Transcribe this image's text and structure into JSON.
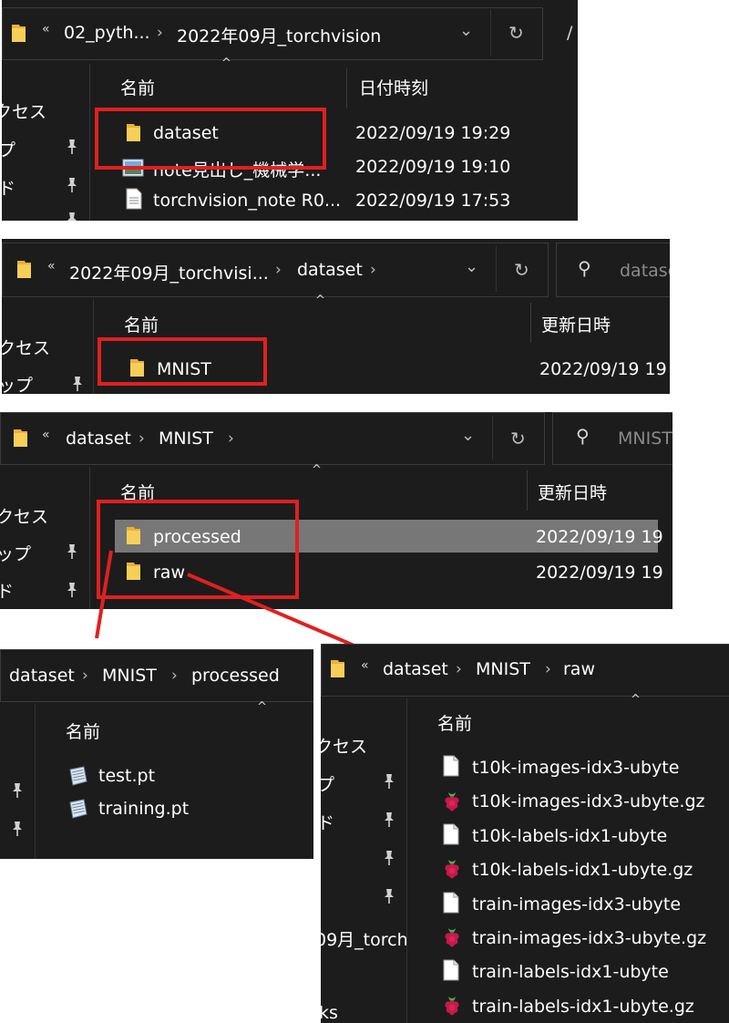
{
  "p1": {
    "breadcrumb": [
      "02_pyth...",
      "2022年09月_torchvision"
    ],
    "prefix": "«",
    "col_name": "名前",
    "col_date": "日付時刻",
    "side": [
      "クセス",
      "プ",
      "ド"
    ],
    "rows": [
      {
        "name": "dataset",
        "date": "2022/09/19 19:29",
        "icon": "folder-icon"
      },
      {
        "name": "note見出し_機械学...",
        "date": "2022/09/19 19:10",
        "icon": "image-file-icon"
      },
      {
        "name": "torchvision_note R0...",
        "date": "2022/09/19 17:53",
        "icon": "document-icon"
      }
    ],
    "extra": "/"
  },
  "p2": {
    "breadcrumb": [
      "2022年09月_torchvisi...",
      "dataset"
    ],
    "prefix": "«",
    "col_name": "名前",
    "col_date": "更新日時",
    "search": "datase",
    "side": [
      "クセス",
      "ップ"
    ],
    "rows": [
      {
        "name": "MNIST",
        "date": "2022/09/19 19"
      }
    ]
  },
  "p3": {
    "breadcrumb": [
      "dataset",
      "MNIST"
    ],
    "prefix": "«",
    "col_name": "名前",
    "col_date": "更新日時",
    "search": "MNIST",
    "side": [
      "クセス",
      "ップ",
      "ド"
    ],
    "rows": [
      {
        "name": "processed",
        "date": "2022/09/19 19",
        "selected": true
      },
      {
        "name": "raw",
        "date": "2022/09/19 19",
        "selected": false
      }
    ]
  },
  "p4": {
    "breadcrumb": [
      "dataset",
      "MNIST",
      "processed"
    ],
    "col_name": "名前",
    "rows": [
      {
        "name": "test.pt"
      },
      {
        "name": "training.pt"
      }
    ]
  },
  "p5": {
    "breadcrumb": [
      "dataset",
      "MNIST",
      "raw"
    ],
    "prefix": "«",
    "col_name": "名前",
    "side": [
      "クセス",
      "プ",
      "ド",
      "09月_torch",
      "ks"
    ],
    "rows": [
      {
        "name": "t10k-images-idx3-ubyte",
        "icon": "blank-file-icon"
      },
      {
        "name": "t10k-images-idx3-ubyte.gz",
        "icon": "raspberry-icon"
      },
      {
        "name": "t10k-labels-idx1-ubyte",
        "icon": "blank-file-icon"
      },
      {
        "name": "t10k-labels-idx1-ubyte.gz",
        "icon": "raspberry-icon"
      },
      {
        "name": "train-images-idx3-ubyte",
        "icon": "blank-file-icon"
      },
      {
        "name": "train-images-idx3-ubyte.gz",
        "icon": "raspberry-icon"
      },
      {
        "name": "train-labels-idx1-ubyte",
        "icon": "blank-file-icon"
      },
      {
        "name": "train-labels-idx1-ubyte.gz",
        "icon": "raspberry-icon"
      }
    ]
  },
  "colors": {
    "highlight": "#e02020",
    "panel_bg": "#1c1c1c",
    "folder": "#f0c040",
    "selection": "#777777"
  }
}
